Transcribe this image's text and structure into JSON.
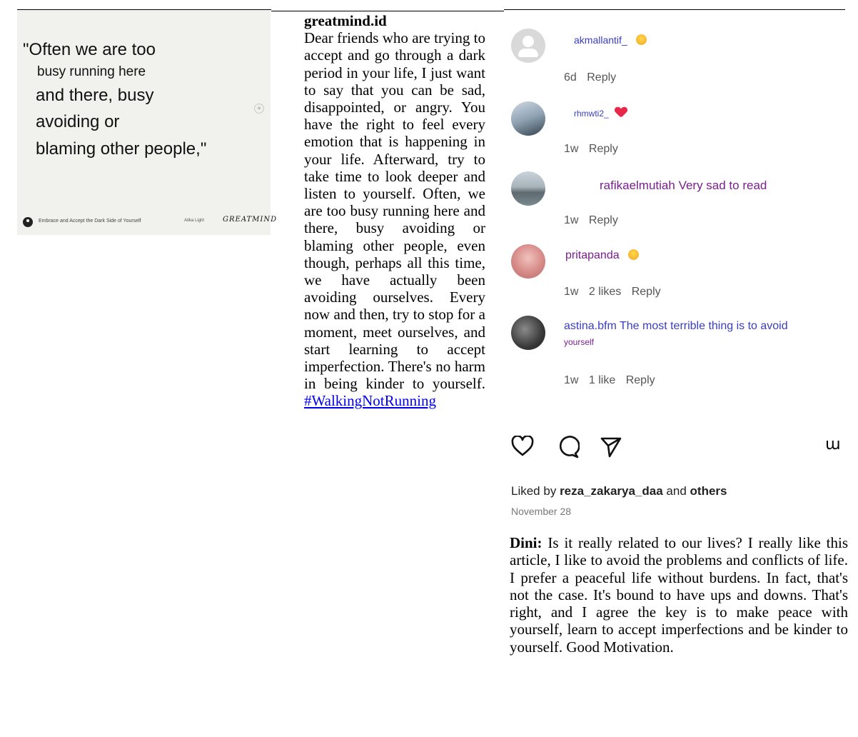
{
  "post_image": {
    "quote_lines": [
      "\"Often we are too",
      "busy running here",
      "and there, busy",
      "avoiding or",
      "blaming other people,\""
    ],
    "footer_title": "Embrace and Accept the Dark Side of Yourself",
    "footer_author": "Atika Light",
    "footer_brand": "GREATMIND"
  },
  "caption": {
    "account": "greatmind.id",
    "text": "Dear friends who are trying to accept and go through a dark period in your life, I just want to say that you can be sad, disappointed, or angry. You have the right to feel every emotion that is happening in your life. Afterward, try to take time to look deeper and listen to yourself. Often, we are too busy running here and there, busy avoiding or blaming other people, even though, perhaps all this time, we have actually been avoiding ourselves. Every now and then, try to stop for a moment, meet ourselves, and start learning to accept imperfection. There's no harm in being kinder to yourself.",
    "hashtag": "#WalkingNotRunning"
  },
  "comments": [
    {
      "user": "akmallantif_",
      "text": "",
      "time": "6d",
      "likes": "",
      "reply": "Reply",
      "avatar": "default-avatar",
      "emoji": "grinning-face"
    },
    {
      "user": "rhmwti2_",
      "text": "",
      "time": "1w",
      "likes": "",
      "reply": "Reply",
      "avatar": "photo-avatar",
      "emoji": "red-heart"
    },
    {
      "user": "rafikaelmutiah",
      "text": "Very sad to read",
      "time": "1w",
      "likes": "",
      "reply": "Reply",
      "avatar": "photo-avatar"
    },
    {
      "user": "pritapanda",
      "text": "",
      "time": "1w",
      "likes": "2 likes",
      "reply": "Reply",
      "avatar": "photo-avatar",
      "emoji": "grinning-face"
    },
    {
      "user": "astina.bfm",
      "text": "The most terrible thing is to avoid",
      "text2": "yourself",
      "time": "1w",
      "likes": "1 like",
      "reply": "Reply",
      "avatar": "photo-avatar"
    }
  ],
  "actions": {
    "like": "heart-icon",
    "comment": "comment-icon",
    "share": "send-icon",
    "more_glyph": "ɯ"
  },
  "liked_by": {
    "prefix": "Liked by",
    "user": "reza_zakarya_daa",
    "connector": "and",
    "others": "others"
  },
  "post_date": "November 28",
  "response": {
    "author": "Dini:",
    "text": "Is it really related to our lives? I really like this article, I like to avoid the problems and conflicts of life. I prefer a peaceful life without burdens. In fact, that's not the case. It's bound to have ups and downs. That's right, and I agree the key is to make peace with yourself, learn to accept imperfections and be kinder to yourself. Good Motivation."
  },
  "colors": {
    "comment_user": "#3a3dc4",
    "comment_purple": "#7a1f8f",
    "link": "#0000ee",
    "heart": "#e8284a"
  }
}
